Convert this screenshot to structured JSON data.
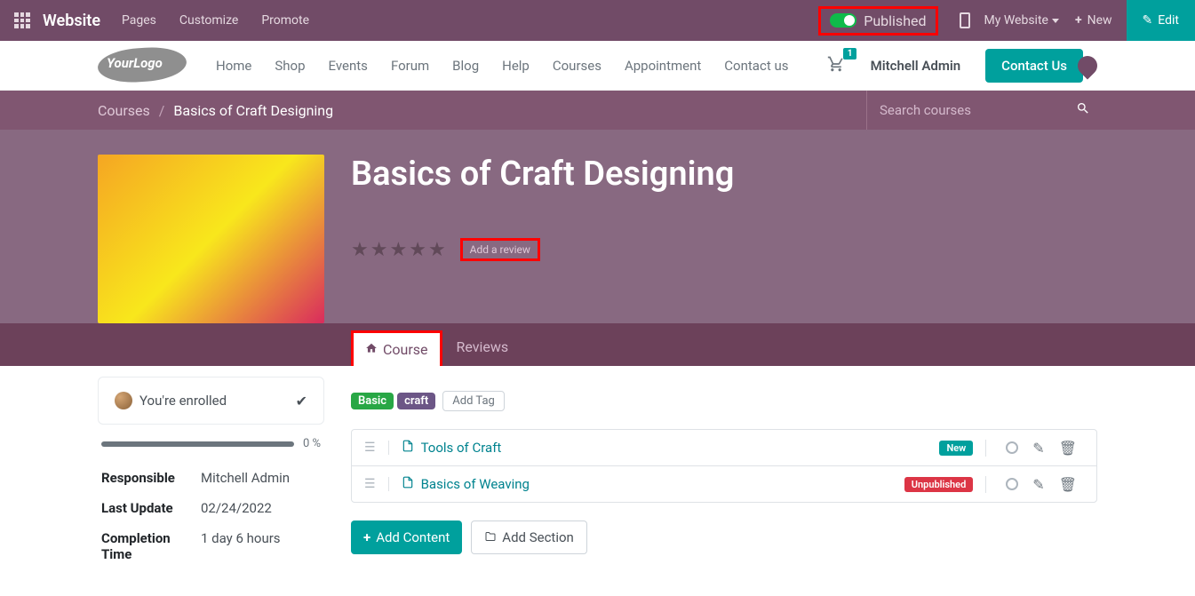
{
  "topbar": {
    "brand": "Website",
    "menu": [
      "Pages",
      "Customize",
      "Promote"
    ],
    "published_label": "Published",
    "mywebsite_label": "My Website",
    "new_label": "New",
    "edit_label": "Edit"
  },
  "navbar": {
    "logo_text": "YourLogo",
    "items": [
      "Home",
      "Shop",
      "Events",
      "Forum",
      "Blog",
      "Help",
      "Courses",
      "Appointment",
      "Contact us"
    ],
    "cart_count": "1",
    "user": "Mitchell Admin",
    "contact_label": "Contact Us"
  },
  "breadcrumb": {
    "root": "Courses",
    "current": "Basics of Craft Designing",
    "search_placeholder": "Search courses"
  },
  "course": {
    "title": "Basics of Craft Designing",
    "add_review": "Add a review"
  },
  "tabs": {
    "course": "Course",
    "reviews": "Reviews"
  },
  "sidebar": {
    "enrolled_text": "You're enrolled",
    "progress_pct": "0 %",
    "meta": [
      {
        "label": "Responsible",
        "value": "Mitchell Admin"
      },
      {
        "label": "Last Update",
        "value": "02/24/2022"
      },
      {
        "label": "Completion Time",
        "value": "1 day 6 hours"
      }
    ]
  },
  "tags": {
    "items": [
      {
        "text": "Basic",
        "cls": "green"
      },
      {
        "text": "craft",
        "cls": "purple"
      }
    ],
    "add_label": "Add Tag"
  },
  "contents": [
    {
      "title": "Tools of Craft",
      "badge": "New",
      "badge_cls": "badge-new"
    },
    {
      "title": "Basics of Weaving",
      "badge": "Unpublished",
      "badge_cls": "badge-unpub"
    }
  ],
  "actions": {
    "add_content": "Add Content",
    "add_section": "Add Section"
  }
}
